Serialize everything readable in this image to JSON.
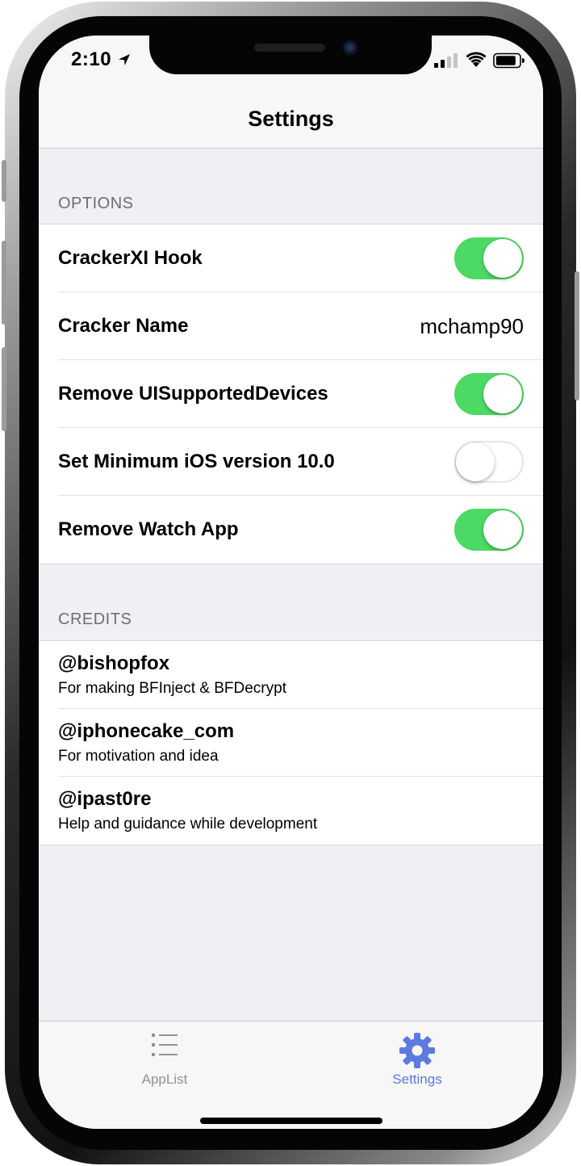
{
  "status_bar": {
    "time": "2:10",
    "icons": [
      "location-arrow-icon",
      "cellular-signal-icon",
      "wifi-icon",
      "battery-icon"
    ]
  },
  "nav": {
    "title": "Settings"
  },
  "sections": {
    "options": {
      "header": "OPTIONS",
      "rows": [
        {
          "label": "CrackerXI Hook",
          "type": "toggle",
          "on": true
        },
        {
          "label": "Cracker Name",
          "type": "value",
          "value": "mchamp90"
        },
        {
          "label": "Remove UISupportedDevices",
          "type": "toggle",
          "on": true
        },
        {
          "label": "Set Minimum iOS version 10.0",
          "type": "toggle",
          "on": false
        },
        {
          "label": "Remove Watch App",
          "type": "toggle",
          "on": true
        }
      ]
    },
    "credits": {
      "header": "CREDITS",
      "rows": [
        {
          "title": "@bishopfox",
          "subtitle": "For making BFInject & BFDecrypt"
        },
        {
          "title": "@iphonecake_com",
          "subtitle": "For motivation and idea"
        },
        {
          "title": "@ipast0re",
          "subtitle": "Help and guidance while development"
        }
      ]
    }
  },
  "tab_bar": {
    "tabs": [
      {
        "label": "AppList",
        "icon": "list-icon",
        "selected": false
      },
      {
        "label": "Settings",
        "icon": "gear-icon",
        "selected": true
      }
    ]
  },
  "colors": {
    "toggle_on": "#4cd964",
    "tab_selected": "#5b7be0",
    "tab_unselected": "#929292",
    "grouped_background": "#efeff4"
  }
}
